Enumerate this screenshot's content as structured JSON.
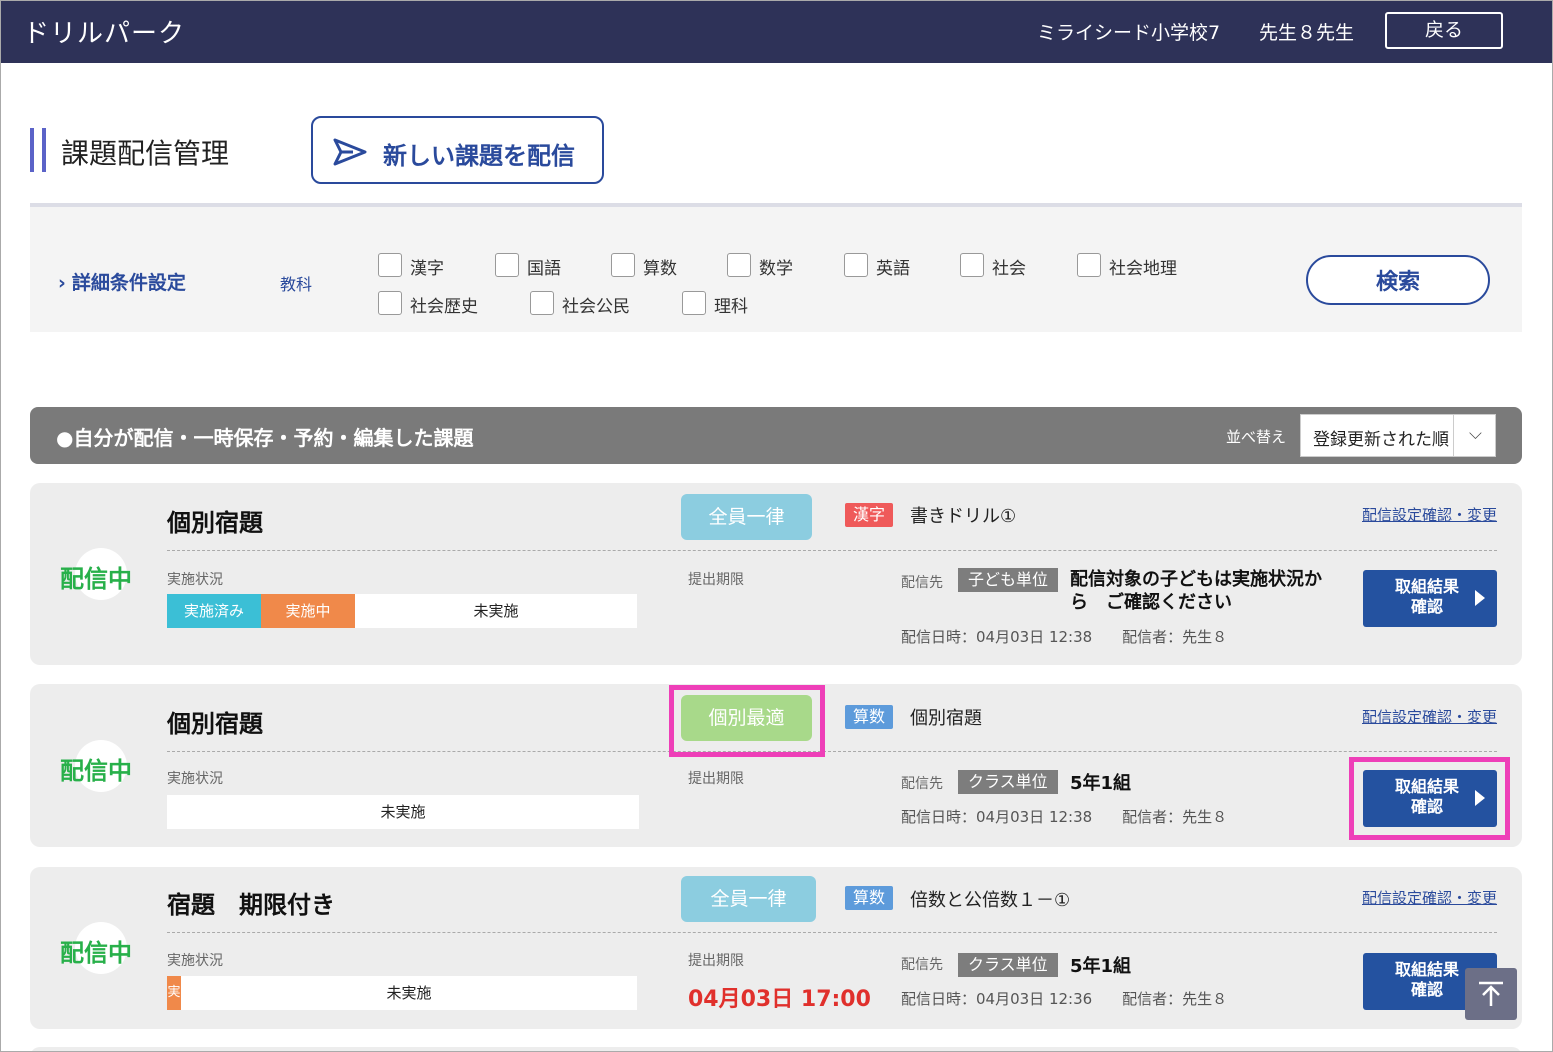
{
  "header": {
    "app_name": "ドリルパーク",
    "school": "ミライシード小学校7",
    "teacher": "先生８先生",
    "back_label": "戻る"
  },
  "page": {
    "title": "課題配信管理",
    "new_button_label": "新しい課題を配信"
  },
  "filter": {
    "detail_toggle": "詳細条件設定",
    "subject_label": "教科",
    "subjects": [
      "漢字",
      "国語",
      "算数",
      "数学",
      "英語",
      "社会",
      "社会地理",
      "社会歴史",
      "社会公民",
      "理科"
    ],
    "search_label": "検索"
  },
  "section": {
    "title": "●自分が配信・一時保存・予約・編集した課題",
    "sort_label": "並べ替え",
    "sort_value": "登録更新された順"
  },
  "labels": {
    "progress_label": "実施状況",
    "deadline_label": "提出期限",
    "target_label": "配信先",
    "settings_link": "配信設定確認・変更",
    "result_button_line1": "取組結果",
    "result_button_line2": "確認"
  },
  "cards": [
    {
      "status": "配信中",
      "title": "個別宿題",
      "mode": "全員一律",
      "subject_tag": "漢字",
      "drill": "書きドリル①",
      "progress": {
        "done_label": "実施済み",
        "doing_label": "実施中",
        "todo_label": "未実施",
        "done": 0.2,
        "doing": 0.2,
        "todo": 0.6
      },
      "deadline": "",
      "target_type": "子ども単位",
      "target_value": "配信対象の子どもは実施状況から　ご確認ください",
      "meta": "配信日時：04月03日 12:38　　配信者：先生８"
    },
    {
      "status": "配信中",
      "title": "個別宿題",
      "mode": "個別最適",
      "subject_tag": "算数",
      "drill": "個別宿題",
      "progress": {
        "done_label": "",
        "doing_label": "",
        "todo_label": "未実施",
        "done": 0,
        "doing": 0,
        "todo": 1
      },
      "deadline": "",
      "target_type": "クラス単位",
      "target_value": "5年1組",
      "meta": "配信日時：04月03日 12:38　　配信者：先生８"
    },
    {
      "status": "配信中",
      "title": "宿題　期限付き",
      "mode": "全員一律",
      "subject_tag": "算数",
      "drill": "倍数と公倍数１－①",
      "progress": {
        "done_label": "",
        "doing_label": "実",
        "todo_label": "未実施",
        "done": 0,
        "doing": 0.03,
        "todo": 0.97
      },
      "deadline": "04月03日 17:00",
      "target_type": "クラス単位",
      "target_value": "5年1組",
      "meta": "配信日時：04月03日 12:36　　配信者：先生８"
    }
  ],
  "colors": {
    "header_bg": "#2e3258",
    "accent": "#2a4a9c",
    "status_green": "#28b04a",
    "mode_uniform": "#8ccde0",
    "mode_individual": "#a8d98a",
    "tag_kanji": "#ef5a5a",
    "tag_math": "#5d9bdb",
    "progress_done": "#3bbfd6",
    "progress_doing": "#f0894a",
    "deadline_red": "#e0302c",
    "highlight": "#ee3fb8"
  }
}
